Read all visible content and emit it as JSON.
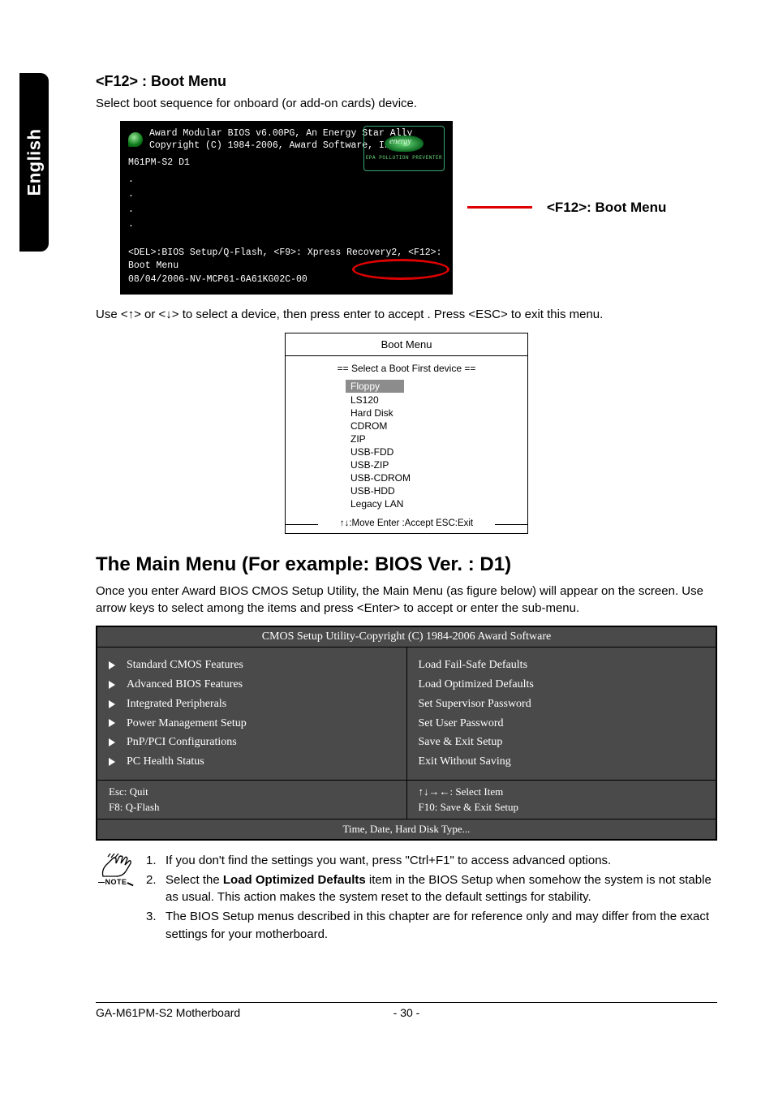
{
  "lang_tab": "English",
  "section1": {
    "title": "<F12> : Boot Menu",
    "desc": "Select boot sequence for onboard (or add-on cards) device."
  },
  "bios_screen": {
    "line1": "Award Modular BIOS v6.00PG, An Energy Star Ally",
    "line2": "Copyright  (C)  1984-2006,  Award Software,    Inc.",
    "board": "M61PM-S2 D1",
    "energy_sub": "EPA   POLLUTION PREVENTER",
    "bottom1_a": "<DEL>:BIOS Setup/Q-Flash, <F9>: Xpress Recovery2,",
    "bottom1_b": "<F12>: Boot Menu",
    "bottom2": "08/04/2006-NV-MCP61-6A61KG02C-00"
  },
  "callout": "<F12>: Boot Menu",
  "instr": "Use <↑> or <↓> to select a device, then press enter to accept . Press <ESC> to exit this menu.",
  "boot_menu": {
    "title": "Boot Menu",
    "sub": "==  Select a Boot First device  ==",
    "items": [
      "Floppy",
      "LS120",
      "Hard Disk",
      "CDROM",
      "ZIP",
      "USB-FDD",
      "USB-ZIP",
      "USB-CDROM",
      "USB-HDD",
      "Legacy LAN"
    ],
    "selected_index": 0,
    "foot": "↑↓:Move   Enter :Accept   ESC:Exit"
  },
  "main_menu": {
    "title": "The Main Menu (For example: BIOS Ver. : D1)",
    "desc": "Once you enter Award BIOS CMOS Setup Utility, the Main Menu (as figure below) will appear on the screen.  Use arrow keys to select among the items and press <Enter> to accept or enter the sub-menu."
  },
  "cmos": {
    "title": "CMOS Setup Utility-Copyright (C) 1984-2006 Award Software",
    "left": [
      "Standard CMOS Features",
      "Advanced BIOS Features",
      "Integrated Peripherals",
      "Power Management Setup",
      "PnP/PCI Configurations",
      "PC Health Status"
    ],
    "right": [
      "Load Fail-Safe Defaults",
      "Load Optimized Defaults",
      "Set Supervisor Password",
      "Set User Password",
      "Save & Exit Setup",
      "Exit Without Saving"
    ],
    "help_l1": "Esc: Quit",
    "help_l2": "F8: Q-Flash",
    "help_r1": "↑↓→←: Select Item",
    "help_r2": "F10: Save & Exit Setup",
    "foot": "Time, Date, Hard Disk Type..."
  },
  "notes": {
    "label": "NOTE",
    "items": [
      {
        "n": "1.",
        "t": "If you don't find the settings you want, press \"Ctrl+F1\" to access advanced options."
      },
      {
        "n": "2.",
        "t_pre": "Select the ",
        "t_bold": "Load Optimized Defaults",
        "t_post": " item in the BIOS Setup when somehow the system is not stable as usual. This action makes the system reset to the default settings for stability."
      },
      {
        "n": "3.",
        "t": "The BIOS Setup menus described in this chapter are for reference only and may differ from the exact settings for your motherboard."
      }
    ]
  },
  "footer": {
    "left": "GA-M61PM-S2 Motherboard",
    "center": "- 30 -"
  }
}
